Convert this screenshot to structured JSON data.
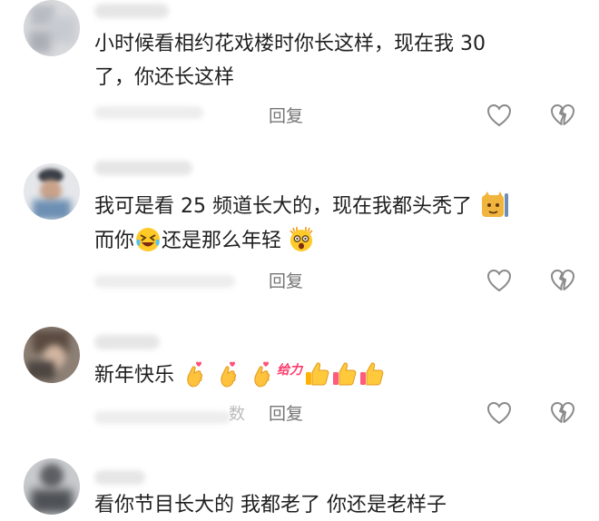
{
  "comments": [
    {
      "text_line1": "小时候看相约花戏楼时你长这样，现在我 30",
      "text_line2": "了，你还长这样",
      "reply_label": "回复"
    },
    {
      "text_line1a": "我可是看 25 频道长大的，现在我都头秃了",
      "text_line2a": "而你",
      "text_line2b": "还是那么年轻",
      "reply_label": "回复"
    },
    {
      "text_a": "新年快乐",
      "sticker_text": "给力",
      "meta_partial": "数",
      "reply_label": "回复"
    },
    {
      "text_line1": "看你节目长大的 我都老了 你还是老样子"
    }
  ],
  "icons": {
    "like": "heart-outline-icon",
    "dislike": "broken-heart-outline-icon",
    "emoji_laugh": "rolling-on-floor-laughing-emoji",
    "emoji_astonished": "astonished-face-emoji",
    "emoji_cat": "cat-face-emoji",
    "emoji_crossed_fingers": "heart-hands-emoji",
    "emoji_thumbs_up": "thumbs-up-emoji"
  },
  "colors": {
    "text": "#1f1f1f",
    "reply": "#757575",
    "icon": "#8a8a8a",
    "sticker": "#ff3b6b"
  }
}
